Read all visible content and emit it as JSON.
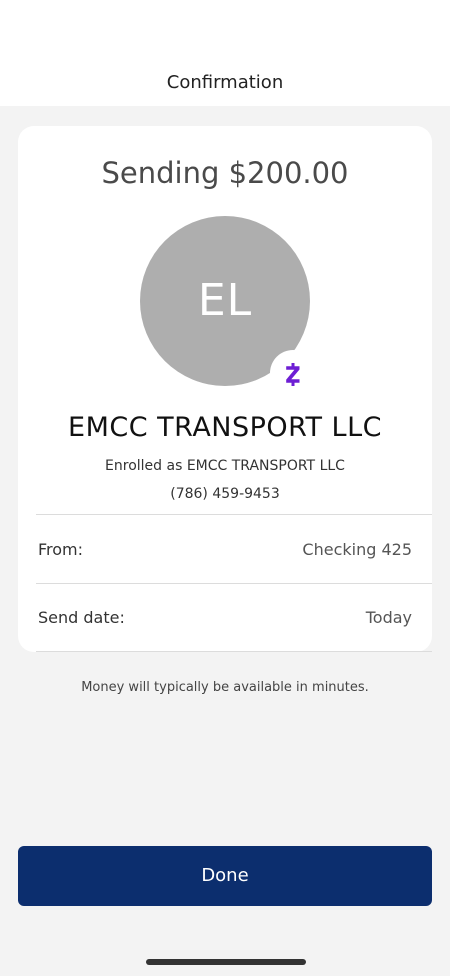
{
  "header": {
    "title": "Confirmation"
  },
  "card": {
    "sending_text": "Sending $200.00",
    "avatar_initials": "EL",
    "badge_icon": "zelle-icon",
    "payee_name": "EMCC TRANSPORT LLC",
    "enrolled_text": "Enrolled as EMCC TRANSPORT LLC",
    "phone": "(786) 459-9453",
    "details": [
      {
        "label": "From:",
        "value": "Checking 425"
      },
      {
        "label": "Send date:",
        "value": "Today"
      }
    ]
  },
  "note": "Money will typically be available in minutes.",
  "done_label": "Done",
  "colors": {
    "primary_button": "#0c2e6e",
    "zelle_purple": "#6d1ed4",
    "avatar_gray": "#aeaeae"
  }
}
